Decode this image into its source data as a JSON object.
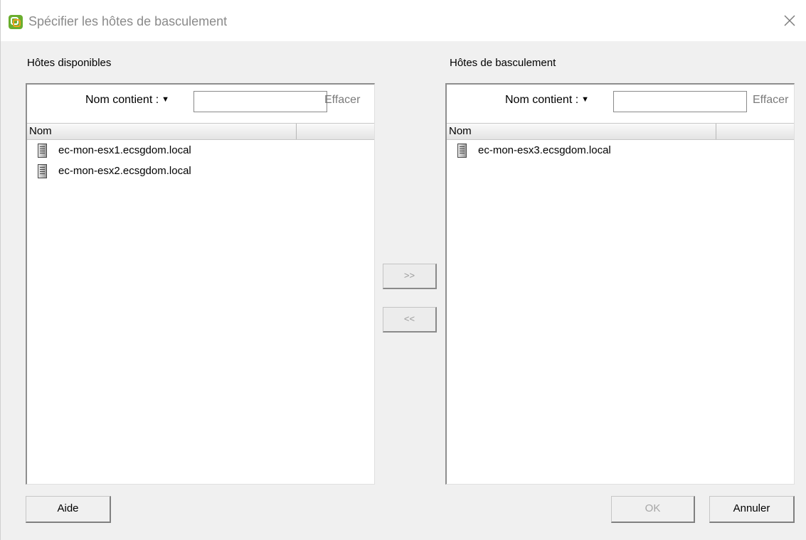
{
  "window": {
    "title": "Spécifier les hôtes de basculement",
    "close_glyph": "✕"
  },
  "left_panel": {
    "group_label": "Hôtes disponibles",
    "filter_label": "Nom contient :",
    "filter_value": "",
    "clear_label": "Effacer",
    "column_name": "Nom",
    "hosts": [
      {
        "name": "ec-mon-esx1.ecsgdom.local",
        "icon": "server-icon"
      },
      {
        "name": "ec-mon-esx2.ecsgdom.local",
        "icon": "server-icon"
      }
    ]
  },
  "right_panel": {
    "group_label": "Hôtes de basculement",
    "filter_label": "Nom contient :",
    "filter_value": "",
    "clear_label": "Effacer",
    "column_name": "Nom",
    "hosts": [
      {
        "name": "ec-mon-esx3.ecsgdom.local",
        "icon": "server-icon"
      }
    ]
  },
  "move": {
    "add_label": ">>",
    "remove_label": "<<"
  },
  "footer": {
    "help_label": "Aide",
    "ok_label": "OK",
    "cancel_label": "Annuler"
  },
  "colors": {
    "app_icon_green": "#6aae2e",
    "app_icon_orange": "#f0a020",
    "dialog_background": "#f0f0f0",
    "disabled_text": "#a6a6a6"
  }
}
